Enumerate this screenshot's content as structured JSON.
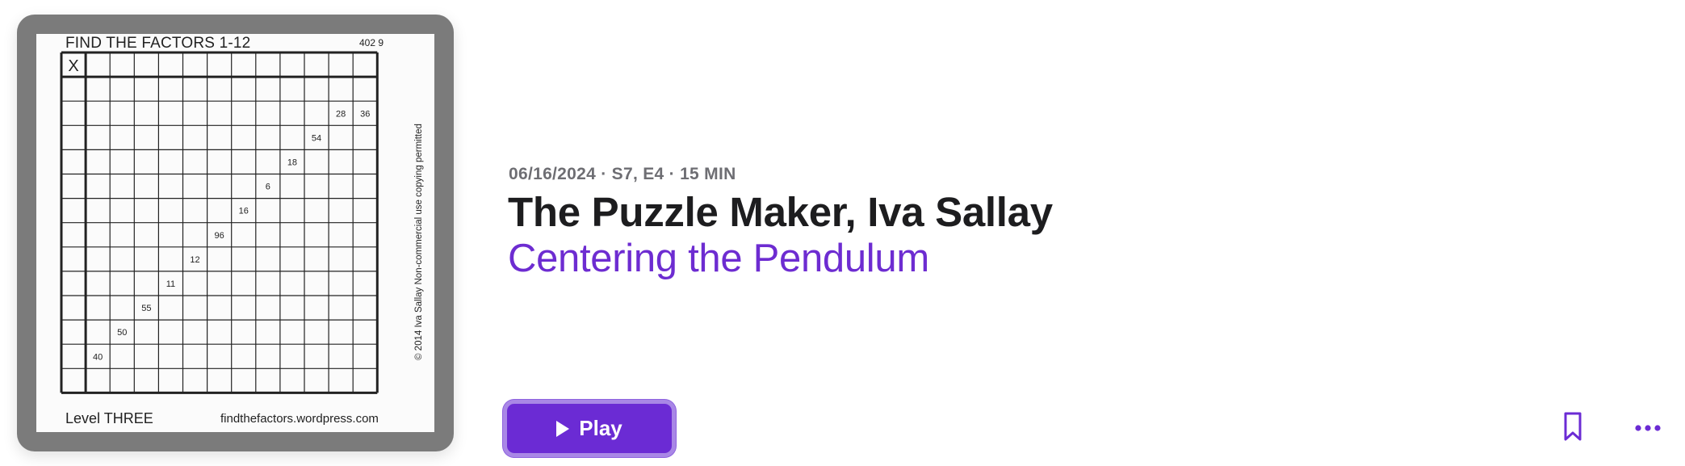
{
  "artwork": {
    "header_title": "FIND THE FACTORS 1-12",
    "header_number": "402 9",
    "corner_label": "X",
    "clues": [
      "28",
      "36",
      "54",
      "18",
      "6",
      "16",
      "96",
      "12",
      "11",
      "55",
      "50",
      "40"
    ],
    "footer_left": "Level THREE",
    "footer_right": "findthefactors.wordpress.com",
    "side_note": "© 2014 Iva Sallay   Non-commercial use copying permitted"
  },
  "episode": {
    "meta": "06/16/2024 · S7, E4 · 15 MIN",
    "title": "The Puzzle Maker, Iva Sallay",
    "show": "Centering the Pendulum"
  },
  "actions": {
    "play_label": "Play",
    "bookmark_icon": "bookmark-icon",
    "more_icon": "more-icon"
  },
  "colors": {
    "accent": "#6b2bd4",
    "subtitle": "#6d2cd1",
    "meta": "#6e6e73",
    "title": "#1d1d1f"
  }
}
